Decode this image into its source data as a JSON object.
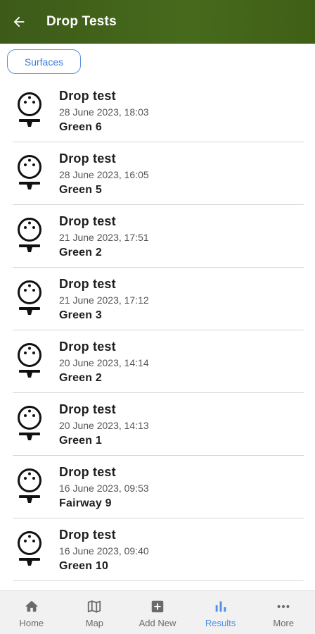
{
  "appbar": {
    "title": "Drop Tests"
  },
  "filters": {
    "chip_label": "Surfaces"
  },
  "items": [
    {
      "title": "Drop test",
      "date": "28 June 2023, 18:03",
      "surface": "Green 6"
    },
    {
      "title": "Drop test",
      "date": "28 June 2023, 16:05",
      "surface": "Green 5"
    },
    {
      "title": "Drop test",
      "date": "21 June 2023, 17:51",
      "surface": "Green 2"
    },
    {
      "title": "Drop test",
      "date": "21 June 2023, 17:12",
      "surface": "Green 3"
    },
    {
      "title": "Drop test",
      "date": "20 June 2023, 14:14",
      "surface": "Green 2"
    },
    {
      "title": "Drop test",
      "date": "20 June 2023, 14:13",
      "surface": "Green 1"
    },
    {
      "title": "Drop test",
      "date": "16 June 2023, 09:53",
      "surface": "Fairway 9"
    },
    {
      "title": "Drop test",
      "date": "16 June 2023, 09:40",
      "surface": "Green 10"
    }
  ],
  "nav": {
    "home": "Home",
    "map": "Map",
    "add_new": "Add New",
    "results": "Results",
    "more": "More"
  },
  "colors": {
    "appbar": "#466a1c",
    "accent": "#4f8fe6"
  }
}
